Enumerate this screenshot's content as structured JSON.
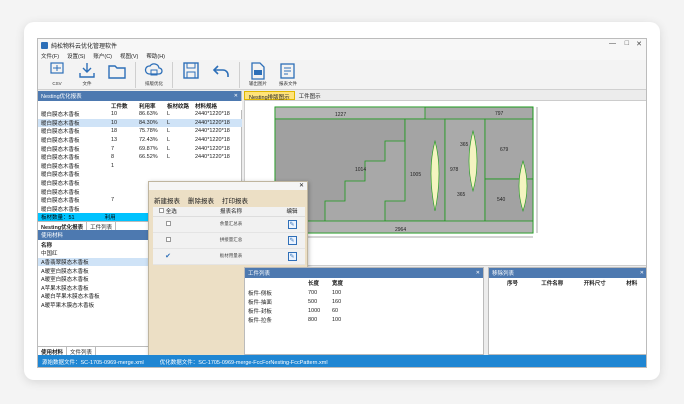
{
  "window": {
    "title": "純松物料云优化管理软件",
    "controls": [
      "—",
      "□",
      "✕"
    ]
  },
  "menu": [
    "文件(F)",
    "设置(S)",
    "账户(C)",
    "视图(V)",
    "帮助(H)"
  ],
  "toolbar": [
    {
      "icon": "csv-export-icon",
      "label": "CSV"
    },
    {
      "icon": "download-icon",
      "label": "文件"
    },
    {
      "icon": "folder-open-icon",
      "label": ""
    },
    {
      "icon": "cloud-optimize-icon",
      "label": "排版优化"
    },
    {
      "icon": "save-icon",
      "label": ""
    },
    {
      "icon": "undo-icon",
      "label": ""
    },
    {
      "icon": "export-file-icon",
      "label": "输出图片"
    },
    {
      "icon": "report-icon",
      "label": "报表文件"
    }
  ],
  "left_panel": {
    "title": "Nesting优化报表",
    "columns": [
      "",
      "工件数",
      "利用率",
      "板材纹路",
      "材料规格"
    ],
    "rows": [
      [
        "暖白膜态木香板",
        "10",
        "86.63%",
        "L",
        "2440*1220*18"
      ],
      [
        "暖白膜态木香板",
        "10",
        "84.30%",
        "L",
        "2440*1220*18"
      ],
      [
        "暖白膜态木香板",
        "18",
        "75.78%",
        "L",
        "2440*1220*18"
      ],
      [
        "暖白膜态木香板",
        "13",
        "72.43%",
        "L",
        "2440*1220*18"
      ],
      [
        "暖白膜态木香板",
        "7",
        "69.87%",
        "L",
        "2440*1220*18"
      ],
      [
        "暖白膜态木香板",
        "8",
        "66.52%",
        "L",
        "2440*1220*18"
      ],
      [
        "暖白膜态木香板",
        "1",
        "",
        "",
        ""
      ],
      [
        "暖白膜态木香板",
        "",
        "",
        "",
        ""
      ],
      [
        "暖白膜态木香板",
        "",
        "",
        "",
        ""
      ],
      [
        "暖白膜态木香板",
        "",
        "",
        "",
        ""
      ],
      [
        "暖白膜态木香板",
        "7",
        "",
        "",
        ""
      ],
      [
        "暖白膜态木香板",
        "",
        "",
        "",
        ""
      ]
    ],
    "summary": "板材数量：51",
    "summary_right": "利用",
    "tabs": [
      "Nesting优化报表",
      "工件列表"
    ],
    "materials_title": "使用材料",
    "materials_column": "名称",
    "materials": [
      "中国红",
      "A香翡翠膜态木香板",
      "A暖室白膜态木香板",
      "A暖室白膜态木香板",
      "A苹果木膜态木香板",
      "A暖白苹果木膜态木香板",
      "A暖苹果木膜态木香板"
    ],
    "materials_tabs": [
      "使用材料",
      "文件列表"
    ]
  },
  "popup": {
    "buttons": [
      "新建报表",
      "删除报表",
      "打印报表"
    ],
    "columns": [
      "全选",
      "报表名称",
      "编辑"
    ],
    "rows": [
      {
        "checked": false,
        "name": "余量汇总表"
      },
      {
        "checked": false,
        "name": "拼接量汇总"
      },
      {
        "checked": true,
        "name": "板材用量表"
      }
    ]
  },
  "doc_tabs": [
    "Nesting排版图示",
    "工件图示"
  ],
  "canvas": {
    "labels": [
      "1227",
      "797",
      "1014",
      "1005",
      "978",
      "365",
      "679",
      "540",
      "365",
      "2964"
    ]
  },
  "bottom_left": {
    "title": "工件列表",
    "columns": [
      "",
      "长度",
      "宽度"
    ],
    "rows": [
      [
        "板件-侧板",
        "700",
        "100"
      ],
      [
        "板件-抽面",
        "500",
        "160"
      ],
      [
        "板件-封板",
        "1000",
        "60"
      ],
      [
        "板件-拉条",
        "800",
        "100"
      ]
    ]
  },
  "bottom_right": {
    "title": "移除列表",
    "columns": [
      "序号",
      "工件名称",
      "开料尺寸",
      "材料"
    ]
  },
  "status": {
    "source": "源始数据文件：SC-1705-0969-merge.xml",
    "optimized": "优化数据文件：SC-1705-0969-merge-FccForNesting-FccPattern.xml"
  },
  "colors": {
    "accent": "#1f86d3",
    "panel_header": "#4d79b0",
    "popup_bg": "#ecdfc5",
    "summary_bar": "#00c3ff",
    "part_fill": "#a8a8a8",
    "part_outline": "#1a9a1a"
  }
}
